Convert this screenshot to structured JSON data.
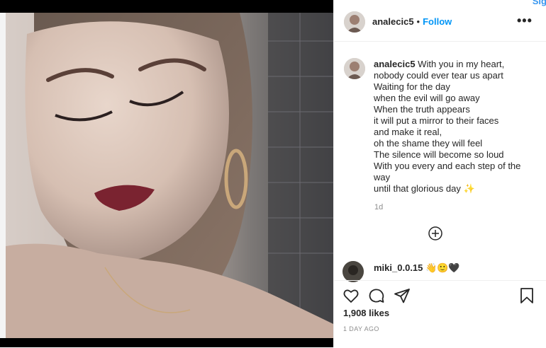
{
  "page": {
    "signup_label": "Sig"
  },
  "post": {
    "username": "analecic5",
    "follow_label": "Follow",
    "separator": "•",
    "more_label": "•••",
    "caption_user": "analecic5",
    "caption_lines": [
      "With you in my heart,",
      "nobody could ever tear us apart",
      "Waiting for the day",
      "when the evil will go away",
      "When the truth appears",
      "it will put a mirror to their faces",
      "and make it real,",
      "oh the shame they will feel",
      "The silence will become so loud",
      "With you every and each step of the",
      "way",
      "until that glorious day ✨"
    ],
    "caption_time": "1d",
    "load_more_icon": "plus-circle-icon",
    "comment": {
      "username": "miki_0.0.15",
      "text": "👋🙂🖤"
    },
    "likes": "1,908 likes",
    "date": "1 DAY AGO"
  },
  "icons": {
    "like": "heart-icon",
    "comment": "comment-icon",
    "share": "share-icon",
    "save": "bookmark-icon"
  },
  "colors": {
    "link_blue": "#0095f6",
    "text": "#262626",
    "muted": "#8e8e8e",
    "border": "#efefef"
  }
}
